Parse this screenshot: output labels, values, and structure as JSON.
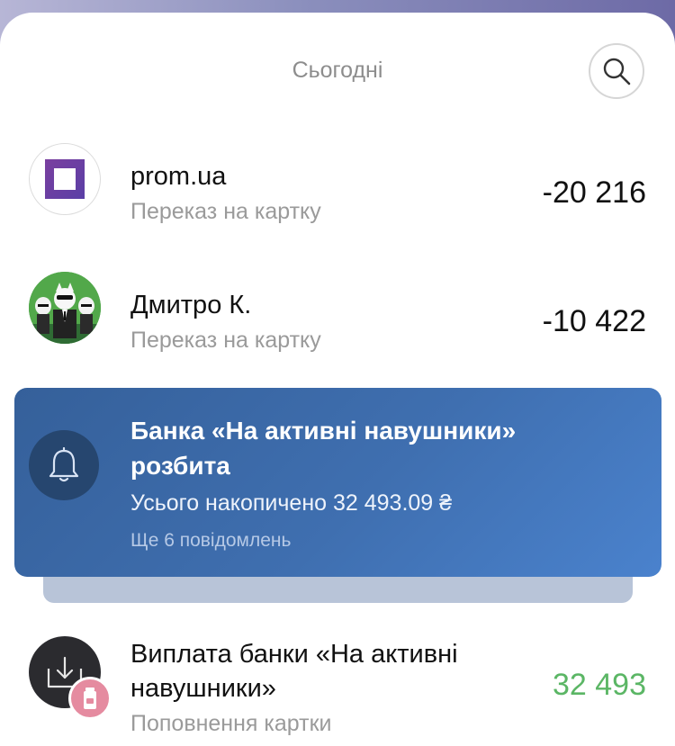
{
  "header": {
    "title": "Сьогодні",
    "search_icon": "search-icon"
  },
  "transactions": [
    {
      "name": "prom.ua",
      "subtitle": "Переказ на картку",
      "amount": "-20 216",
      "avatar_icon": "prom-logo-icon"
    },
    {
      "name": "Дмитро К.",
      "subtitle": "Переказ на картку",
      "amount": "-10 422",
      "avatar_icon": "cats-avatar-icon"
    }
  ],
  "notification": {
    "title": "Банка «На активні навушники» розбита",
    "body": "Усього накопичено 32 493.09 ₴",
    "more": "Ще 6 повідомлень",
    "icon": "bell-icon"
  },
  "payout": {
    "title": "Виплата банки «На активні навушники»",
    "subtitle": "Поповнення картки",
    "amount": "32 493",
    "icon": "download-tray-icon",
    "badge_icon": "jar-icon"
  },
  "colors": {
    "income": "#5bb665",
    "notification_bg": "#3f6fb0",
    "prom_purple": "#6a3fa3"
  }
}
